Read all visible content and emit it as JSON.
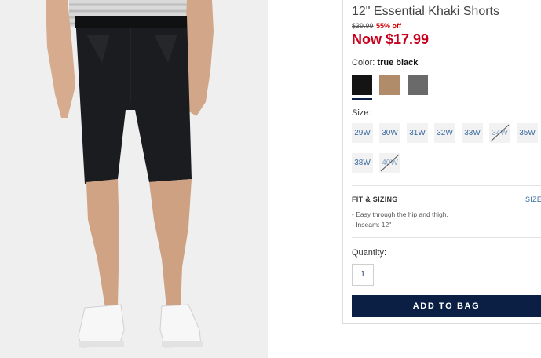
{
  "product": {
    "title": "12\" Essential Khaki Shorts",
    "original_price": "$39.99",
    "discount": "55% off",
    "now_price": "Now $17.99"
  },
  "color": {
    "label": "Color:",
    "selected": "true black",
    "swatches": [
      {
        "name": "true black",
        "hex": "#141414",
        "selected": true
      },
      {
        "name": "khaki",
        "hex": "#b08c6b",
        "selected": false
      },
      {
        "name": "grey",
        "hex": "#6a6a6a",
        "selected": false
      }
    ]
  },
  "size": {
    "label": "Size:",
    "options": [
      {
        "label": "29W",
        "available": true
      },
      {
        "label": "30W",
        "available": true
      },
      {
        "label": "31W",
        "available": true
      },
      {
        "label": "32W",
        "available": true
      },
      {
        "label": "33W",
        "available": true
      },
      {
        "label": "34W",
        "available": false
      },
      {
        "label": "35W",
        "available": true
      },
      {
        "label": "38W",
        "available": true
      },
      {
        "label": "40W",
        "available": false
      }
    ]
  },
  "fit": {
    "title": "FIT & SIZING",
    "size_link": "SIZE",
    "details": [
      "- Easy through the hip and thigh.",
      "- Inseam: 12\""
    ]
  },
  "quantity": {
    "label": "Quantity:",
    "value": "1"
  },
  "add_to_bag": "ADD TO BAG",
  "colors": {
    "accent": "#0b1f45",
    "sale": "#c8001e",
    "link": "#3a6aa0"
  }
}
